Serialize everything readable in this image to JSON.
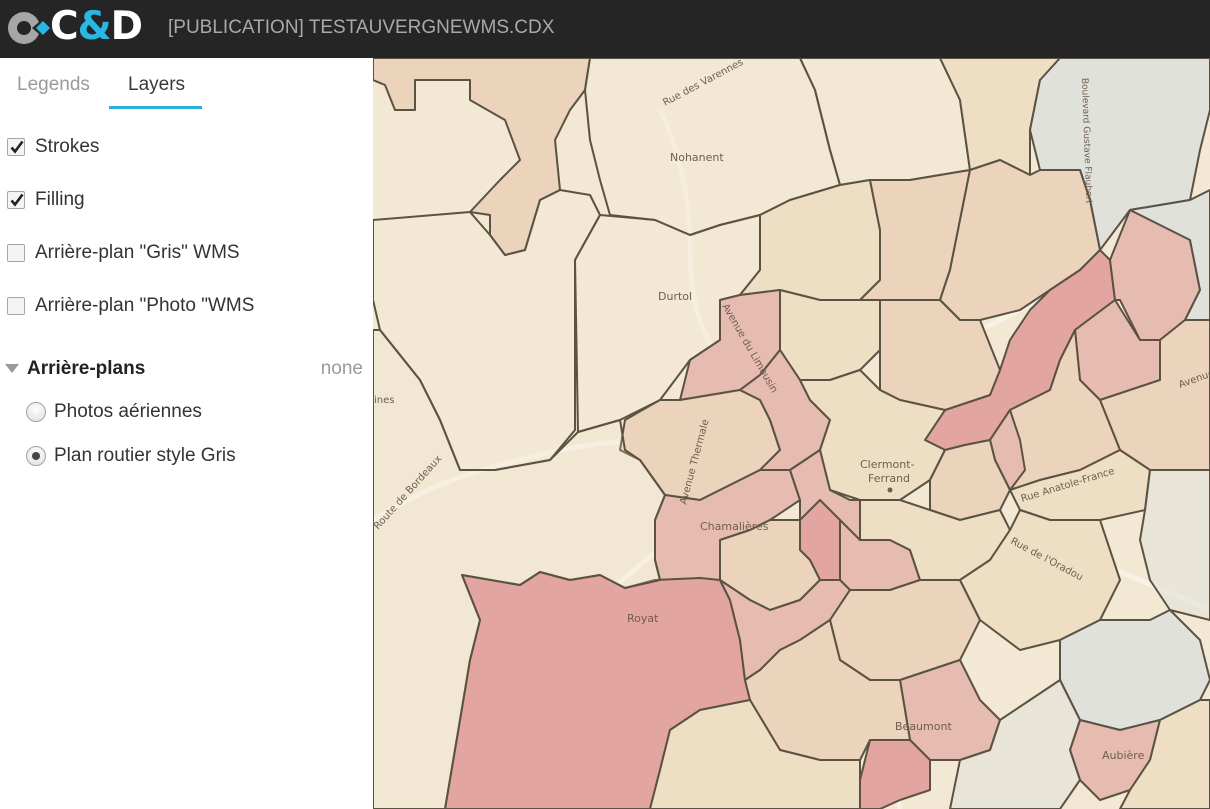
{
  "header": {
    "logo_text": "C&D",
    "title": "[PUBLICATION] TESTAUVERGNEWMS.CDX"
  },
  "tabs": [
    {
      "label": "Legends",
      "active": false
    },
    {
      "label": "Layers",
      "active": true
    }
  ],
  "layers": [
    {
      "label": "Strokes",
      "checked": true
    },
    {
      "label": "Filling",
      "checked": true
    },
    {
      "label": "Arrière-plan \"Gris\" WMS",
      "checked": false
    },
    {
      "label": "Arrière-plan \"Photo \"WMS",
      "checked": false
    }
  ],
  "backgrounds": {
    "title": "Arrière-plans",
    "current": "none",
    "options": [
      {
        "label": "Photos aériennes",
        "selected": false
      },
      {
        "label": "Plan routier style Gris",
        "selected": true
      }
    ]
  },
  "map": {
    "labels": {
      "nohanent": "Nohanent",
      "durtol": "Durtol",
      "clermont1": "Clermont-",
      "clermont2": "Ferrand",
      "chamalieres": "Chamalières",
      "royat": "Royat",
      "beaumont": "Beaumont",
      "aubiere": "Aubière",
      "rue_varennes": "Rue des Varennes",
      "avenue_du_limousin": "Avenue du Limousin",
      "avenue_thermale": "Avenue Thermale",
      "route_bordeaux": "Route de Bordeaux",
      "rue_anatole_france": "Rue Anatole-France",
      "rue_oradou": "Rue de l'Oradou",
      "avenue_right": "Avenue",
      "boulevard_right": "Boulevard Gustave Flaubert",
      "lines_left": "ines"
    },
    "colors": {
      "base": "#f2e8d3",
      "zone_beige": "#eedfc4",
      "zone_tan": "#ebd4bb",
      "zone_pink": "#e6bcb0",
      "zone_red": "#e3a59f",
      "zone_grey": "#e1e1dc",
      "stroke": "#5b5244"
    }
  }
}
